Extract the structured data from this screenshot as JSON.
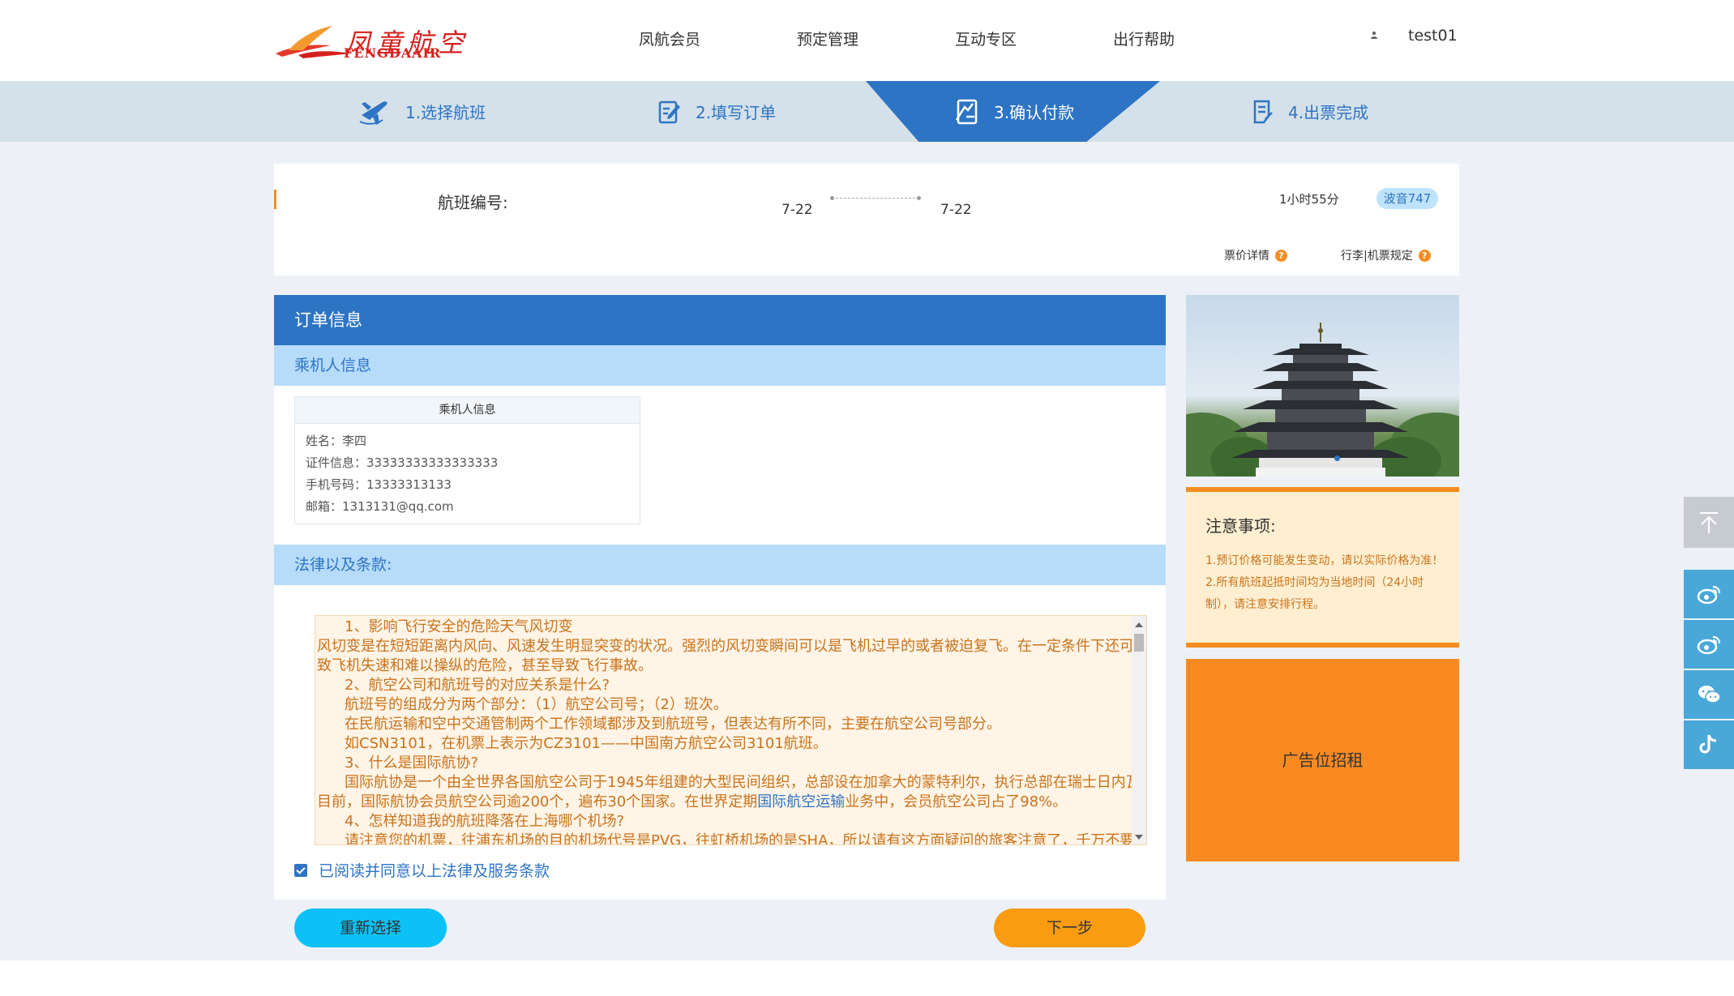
{
  "header": {
    "logo_cn": "凤童航空",
    "logo_en": "FENGDAAIR",
    "nav": [
      "凤航会员",
      "预定管理",
      "互动专区",
      "出行帮助"
    ],
    "user_name": "test01"
  },
  "steps": [
    {
      "label": "1.选择航班",
      "icon": "plane-icon"
    },
    {
      "label": "2.填写订单",
      "icon": "edit-form-icon"
    },
    {
      "label": "3.确认付款",
      "icon": "sign-document-icon"
    },
    {
      "label": "4.出票完成",
      "icon": "ticket-list-icon"
    }
  ],
  "active_step": 2,
  "flight": {
    "label": "航班编号:",
    "dep_date": "7-22",
    "arr_date": "7-22",
    "duration": "1小时55分",
    "aircraft": "波音747",
    "fare_details": "票价详情",
    "baggage_rules": "行李|机票规定",
    "help_glyph": "?"
  },
  "order": {
    "title": "订单信息",
    "passenger_section": "乘机人信息",
    "passenger_box_title": "乘机人信息",
    "passenger": {
      "name": "姓名：李四",
      "id": "证件信息：33333333333333333",
      "phone": "手机号码：13333313133",
      "email": "邮箱：1313131@qq.com"
    },
    "terms_section": "法律以及条款:",
    "terms_lines": [
      {
        "text": "1、影响飞行安全的危险天气风切变",
        "indent": true
      },
      {
        "text": "风切变是在短短距离内风向、风速发生明显突变的状况。强烈的风切变瞬间可以是飞机过早的或者被迫复飞。在一定条件下还可导",
        "indent": false
      },
      {
        "text": "致飞机失速和难以操纵的危险，甚至导致飞行事故。",
        "indent": false
      },
      {
        "text": "2、航空公司和航班号的对应关系是什么?",
        "indent": true
      },
      {
        "text": "航班号的组成分为两个部分：（1）航空公司号；（2）班次。",
        "indent": true
      },
      {
        "text": "在民航运输和空中交通管制两个工作领域都涉及到航班号，但表达有所不同，主要在航空公司号部分。",
        "indent": true
      },
      {
        "text": "如CSN3101，在机票上表示为CZ3101——中国南方航空公司3101航班。",
        "indent": true
      },
      {
        "text": "3、什么是国际航协?",
        "indent": true
      },
      {
        "text": "国际航协是一个由全世界各国航空公司于1945年组建的大型民间组织，总部设在加拿大的蒙特利尔，执行总部在瑞士日内瓦。",
        "indent": true
      }
    ],
    "terms_line_link": {
      "before": "目前，国际航协会员航空公司逾200个，遍布30个国家。在世界定期",
      "link": "国际航空运输",
      "after": "业务中，会员航空公司占了98%。"
    },
    "terms_lines_tail": [
      {
        "text": "4、怎样知道我的航班降落在上海哪个机场?",
        "indent": true
      },
      {
        "text": "请注意您的机票，往浦东机场的目的机场代号是PVG，往虹桥机场的是SHA，所以请有这方面疑问的旅客注意了，千万不要让",
        "indent": true
      }
    ],
    "agree_label": "已阅读并同意以上法律及服务条款",
    "agree_checked": true,
    "reselect_label": "重新选择",
    "next_label": "下一步"
  },
  "notice": {
    "title": "注意事项:",
    "body": "1.预订价格可能发生变动，请以实际价格为准！ 2.所有航班起抵时间均为当地时间（24小时制），请注意安排行程。"
  },
  "ad": {
    "label": "广告位招租"
  },
  "side_buttons": [
    "weibo-icon",
    "weibo-icon",
    "wechat-icon",
    "tiktok-icon"
  ],
  "colors": {
    "primary_blue": "#2e74c4",
    "light_blue": "#b6dcf9",
    "orange": "#f48d1f",
    "ad_orange": "#f98a21",
    "cyan_button": "#0cc1f5",
    "next_button": "#fa9c12"
  }
}
